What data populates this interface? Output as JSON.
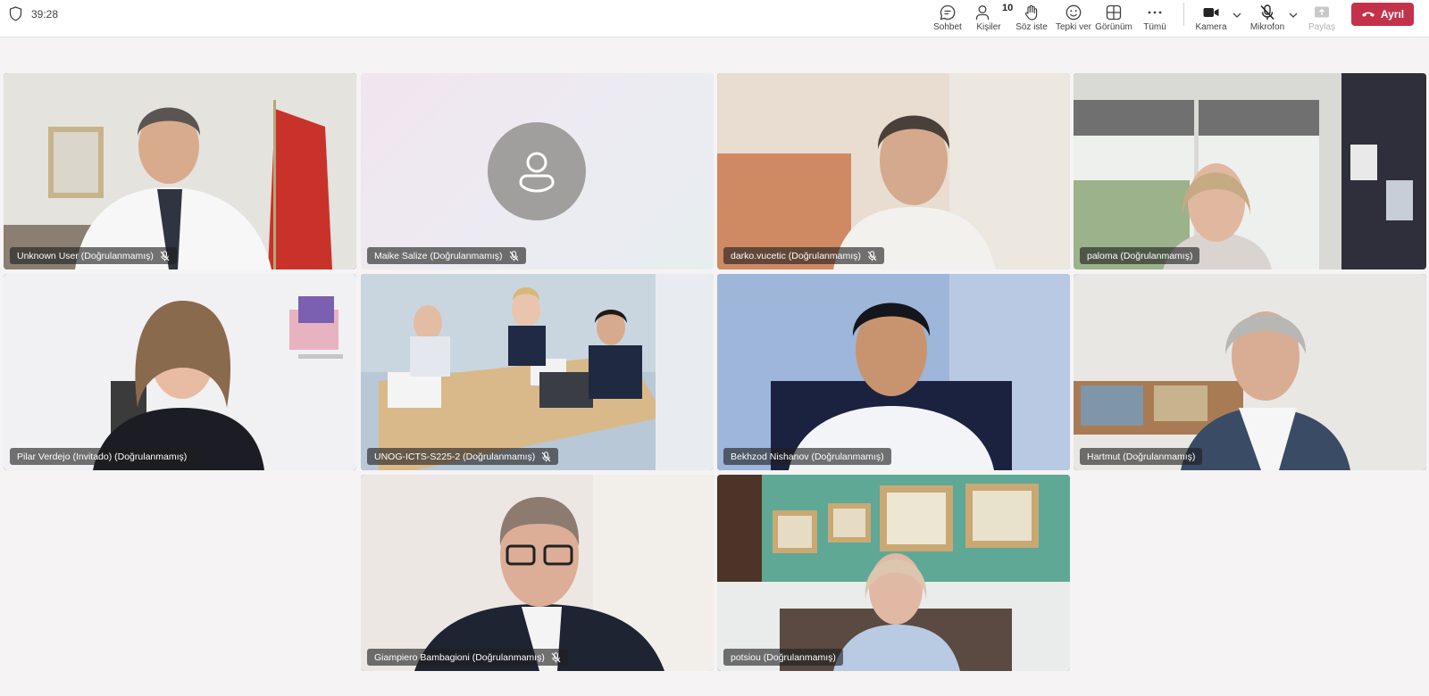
{
  "meeting": {
    "elapsed_time": "39:28"
  },
  "toolbar": {
    "chat_label": "Sohbet",
    "people_label": "Kişiler",
    "people_count": "10",
    "raise_hand_label": "Söz iste",
    "react_label": "Tepki ver",
    "view_label": "Görünüm",
    "more_label": "Tümü",
    "camera_label": "Kamera",
    "mic_label": "Mikrofon",
    "share_label": "Paylaş",
    "leave_label": "Ayrıl"
  },
  "colors": {
    "leave_button": "#c4314b",
    "active_speaker_outline": "#5b5fc7",
    "avatar_background": "#a19f9d"
  },
  "participants": [
    {
      "name": "Unknown User (Doğrulanmamış)",
      "muted": true,
      "active": false
    },
    {
      "name": "Maike Salize (Doğrulanmamış)",
      "muted": true,
      "active": false,
      "video": false
    },
    {
      "name": "darko.vucetic (Doğrulanmamış)",
      "muted": true,
      "active": false
    },
    {
      "name": "paloma (Doğrulanmamış)",
      "muted": false,
      "active": false
    },
    {
      "name": "Pilar Verdejo (Invitado) (Doğrulanmamış)",
      "muted": false,
      "active": true
    },
    {
      "name": "UNOG-ICTS-S225-2 (Doğrulanmamış)",
      "muted": true,
      "active": false
    },
    {
      "name": "Bekhzod Nishanov (Doğrulanmamış)",
      "muted": false,
      "active": false
    },
    {
      "name": "Hartmut (Doğrulanmamış)",
      "muted": false,
      "active": true
    },
    {
      "name": "Giampiero Bambagioni (Doğrulanmamış)",
      "muted": true,
      "active": false
    },
    {
      "name": "potsiou (Doğrulanmamış)",
      "muted": false,
      "active": false
    }
  ]
}
